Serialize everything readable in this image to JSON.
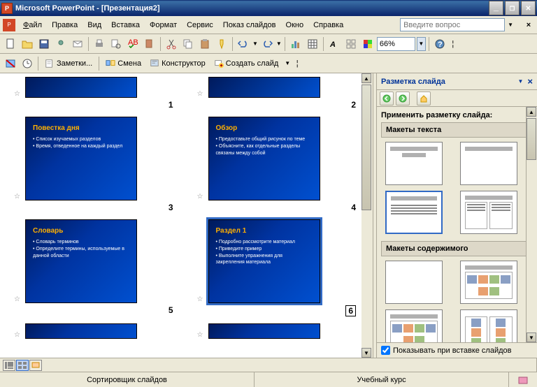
{
  "title": "Microsoft PowerPoint - [Презентация2]",
  "menus": {
    "file": "Файл",
    "edit": "Правка",
    "view": "Вид",
    "insert": "Вставка",
    "format": "Формат",
    "tools": "Сервис",
    "slideshow": "Показ слайдов",
    "window": "Окно",
    "help": "Справка"
  },
  "help_placeholder": "Введите вопрос",
  "zoom": "66%",
  "toolbar2": {
    "notes": "Заметки...",
    "change": "Смена",
    "designer": "Конструктор",
    "newslide": "Создать слайд"
  },
  "slides": [
    {
      "num": "1",
      "title": "",
      "body": ""
    },
    {
      "num": "2",
      "title": "",
      "body": ""
    },
    {
      "num": "3",
      "title": "Повестка дня",
      "body": "• Список изучаемых разделов<br>• Время, отведенное на каждый раздел"
    },
    {
      "num": "4",
      "title": "Обзор",
      "body": "• Предоставьте общий рисунок по теме<br>• Объясните, как отдельные разделы связаны между собой"
    },
    {
      "num": "5",
      "title": "Словарь",
      "body": "• Словарь терминов<br>• Определите термины, используемые в данной области"
    },
    {
      "num": "6",
      "title": "Раздел 1",
      "body": "• Подробно рассмотрите материал<br>• Приведите пример<br>• Выполните упражнения для закрепления материала",
      "selected": true
    }
  ],
  "taskpane": {
    "title": "Разметка слайда",
    "apply": "Применить разметку слайда:",
    "sec1": "Макеты текста",
    "sec2": "Макеты содержимого",
    "footer": "Показывать при вставке слайдов"
  },
  "status": {
    "view": "Сортировщик слайдов",
    "course": "Учебный курс"
  },
  "chart_data": null
}
